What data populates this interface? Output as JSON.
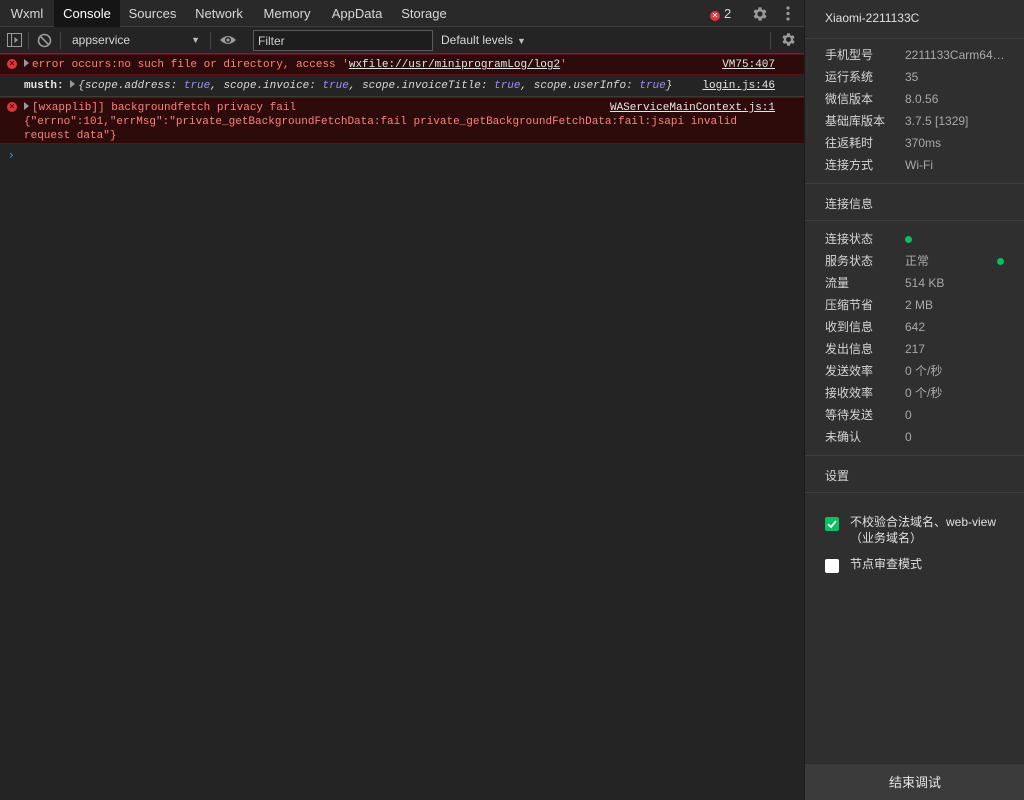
{
  "tabs": [
    {
      "label": "Wxml"
    },
    {
      "label": "Console",
      "active": true
    },
    {
      "label": "Sources"
    },
    {
      "label": "Network"
    },
    {
      "label": "Memory"
    },
    {
      "label": "AppData"
    },
    {
      "label": "Storage"
    }
  ],
  "error_count": "2",
  "toolbar": {
    "context": "appservice",
    "filter_placeholder": "Filter",
    "levels": "Default levels"
  },
  "console": {
    "messages": [
      {
        "level": "error",
        "text_prefix": "error occurs:no such file or directory, access '",
        "text_link": "wxfile://usr/miniprogramLog/log2",
        "text_suffix": "'",
        "source": "VM75:407"
      },
      {
        "level": "log",
        "label": "musth:",
        "object": "{scope.address: true, scope.invoice: true, scope.invoiceTitle: true, scope.userInfo: true}",
        "source": "login.js:46"
      },
      {
        "level": "error",
        "line1": "[wxapplib]] backgroundfetch privacy fail",
        "line2": "{\"errno\":101,\"errMsg\":\"private_getBackgroundFetchData:fail private_getBackgroundFetchData:fail:jsapi invalid",
        "line3": "request data\"}",
        "source": "WAServiceMainContext.js:1"
      }
    ],
    "prompt": "›"
  },
  "panel": {
    "device_name": "Xiaomi-2211133C",
    "device_info": [
      {
        "key": "手机型号",
        "value": "2211133Carm64…"
      },
      {
        "key": "运行系统",
        "value": "35"
      },
      {
        "key": "微信版本",
        "value": "8.0.56"
      },
      {
        "key": "基础库版本",
        "value": "3.7.5 [1329]"
      },
      {
        "key": "往返耗时",
        "value": "370ms"
      },
      {
        "key": "连接方式",
        "value": "Wi-Fi"
      }
    ],
    "connection_title": "连接信息",
    "connection": [
      {
        "key": "连接状态",
        "value": ""
      },
      {
        "key": "服务状态",
        "value": "正常"
      },
      {
        "key": "流量",
        "value": "514 KB"
      },
      {
        "key": "压缩节省",
        "value": "2 MB"
      },
      {
        "key": "收到信息",
        "value": "642"
      },
      {
        "key": "发出信息",
        "value": "217"
      },
      {
        "key": "发送效率",
        "value": "0 个/秒"
      },
      {
        "key": "接收效率",
        "value": "0 个/秒"
      },
      {
        "key": "等待发送",
        "value": "0"
      },
      {
        "key": "未确认",
        "value": "0"
      }
    ],
    "settings_title": "设置",
    "settings": [
      {
        "label": "不校验合法域名、web-view（业务域名）",
        "checked": true
      },
      {
        "label": "节点审查模式",
        "checked": false
      }
    ],
    "end_debug": "结束调试"
  },
  "colors": {
    "accent_green": "#07c160",
    "error_red": "#e0353d",
    "boolean_purple": "#9b8cff"
  }
}
